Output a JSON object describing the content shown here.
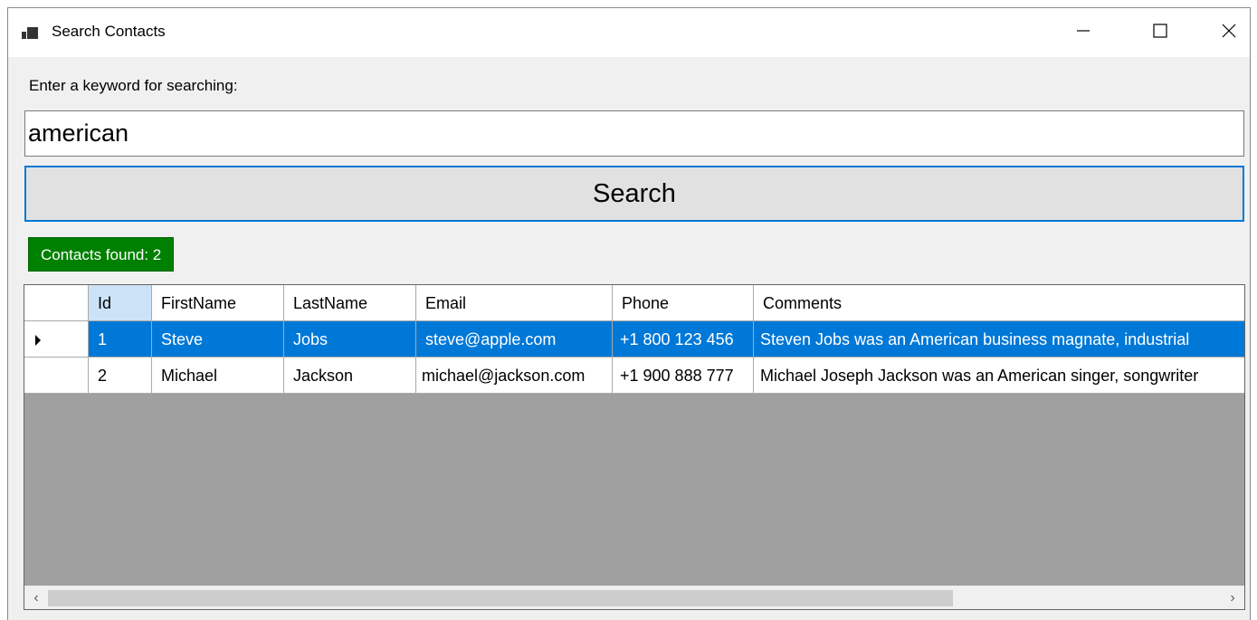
{
  "window": {
    "title": "Search Contacts",
    "icon": "app-window-icon",
    "controls": {
      "minimize": "minimize-icon",
      "maximize": "maximize-icon",
      "close": "close-icon"
    }
  },
  "search": {
    "label": "Enter a keyword for searching:",
    "value": "american",
    "button_label": "Search"
  },
  "status": {
    "text": "Contacts found: 2",
    "color": "#008000"
  },
  "grid": {
    "columns": [
      "Id",
      "FirstName",
      "LastName",
      "Email",
      "Phone",
      "Comments"
    ],
    "rows": [
      {
        "id": "1",
        "first": "Steve",
        "last": "Jobs",
        "email": "steve@apple.com",
        "phone": "+1 800 123 456",
        "comments": "Steven Jobs was an American business magnate, industrial"
      },
      {
        "id": "2",
        "first": "Michael",
        "last": "Jackson",
        "email": "michael@jackson.com",
        "phone": "+1 900 888 777",
        "comments": "Michael Joseph Jackson was an American singer, songwriter"
      }
    ],
    "selected_color": "#0078d7",
    "scroll": {
      "left": "‹",
      "right": "›"
    }
  }
}
